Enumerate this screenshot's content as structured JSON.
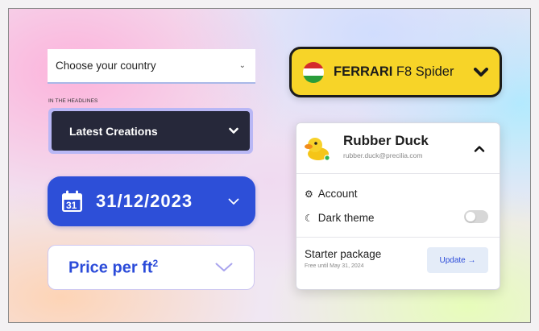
{
  "country_select": {
    "value": "Choose your country",
    "chevron": "chevron-down-icon"
  },
  "headlines": {
    "label": "IN THE HEADLINES",
    "value": "Latest Creations",
    "chevron": "chevron-down-icon"
  },
  "date_picker": {
    "value": "31/12/2023",
    "calendar_day": "31",
    "icon": "calendar-icon",
    "chevron": "chevron-down-icon"
  },
  "price_select": {
    "label": "Price per ft",
    "superscript": "2",
    "chevron": "chevron-down-icon"
  },
  "car_select": {
    "brand": "FERRARI",
    "model": " F8 Spider",
    "flag_colors": [
      "#d42b2b",
      "#ffffff",
      "#2a9d3a"
    ],
    "chevron": "chevron-down-icon"
  },
  "profile_card": {
    "name": "Rubber Duck",
    "email": "rubber.duck@precilia.com",
    "status_color": "#2fb24c",
    "items": [
      {
        "label": "Account",
        "icon": "gear-icon"
      },
      {
        "label": "Dark theme",
        "icon": "moon-icon",
        "toggle": false
      }
    ],
    "package": {
      "title": "Starter package",
      "subtitle": "Free until May 31, 2024",
      "button": "Update →"
    }
  },
  "colors": {
    "accent_blue": "#2d4fd8",
    "dark_select": "#26283a",
    "ferrari_yellow": "#f7d428"
  }
}
